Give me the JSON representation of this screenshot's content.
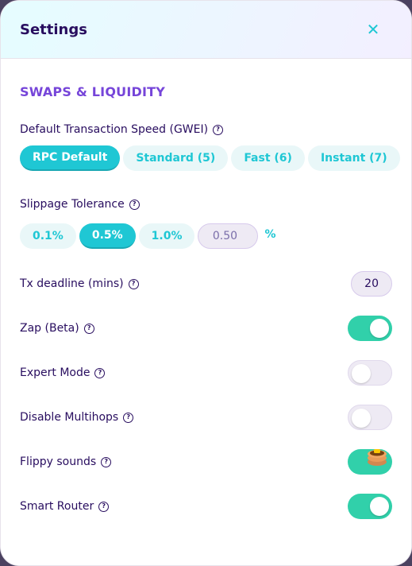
{
  "header": {
    "title": "Settings",
    "close_icon": "close-icon"
  },
  "section": {
    "title": "SWAPS & LIQUIDITY"
  },
  "gas": {
    "label": "Default Transaction Speed (GWEI)",
    "options": [
      "RPC Default",
      "Standard (5)",
      "Fast (6)",
      "Instant (7)"
    ],
    "selected": "RPC Default"
  },
  "slippage": {
    "label": "Slippage Tolerance",
    "options": [
      "0.1%",
      "0.5%",
      "1.0%"
    ],
    "selected": "0.5%",
    "input_placeholder": "0.50",
    "unit": "%"
  },
  "deadline": {
    "label": "Tx deadline (mins)",
    "value": "20"
  },
  "toggles": [
    {
      "label": "Zap (Beta)",
      "on": true
    },
    {
      "label": "Expert Mode",
      "on": false
    },
    {
      "label": "Disable Multihops",
      "on": false
    },
    {
      "label": "Flippy sounds",
      "on": true
    },
    {
      "label": "Smart Router",
      "on": true
    }
  ],
  "help_icon": "question-circle-icon",
  "help_glyph": "?",
  "close_glyph": "✕",
  "colors": {
    "primary": "#1fc7d4",
    "secondary": "#7645d9",
    "text": "#280d5f",
    "success": "#31d0aa",
    "input_bg": "#eeeaf4"
  }
}
